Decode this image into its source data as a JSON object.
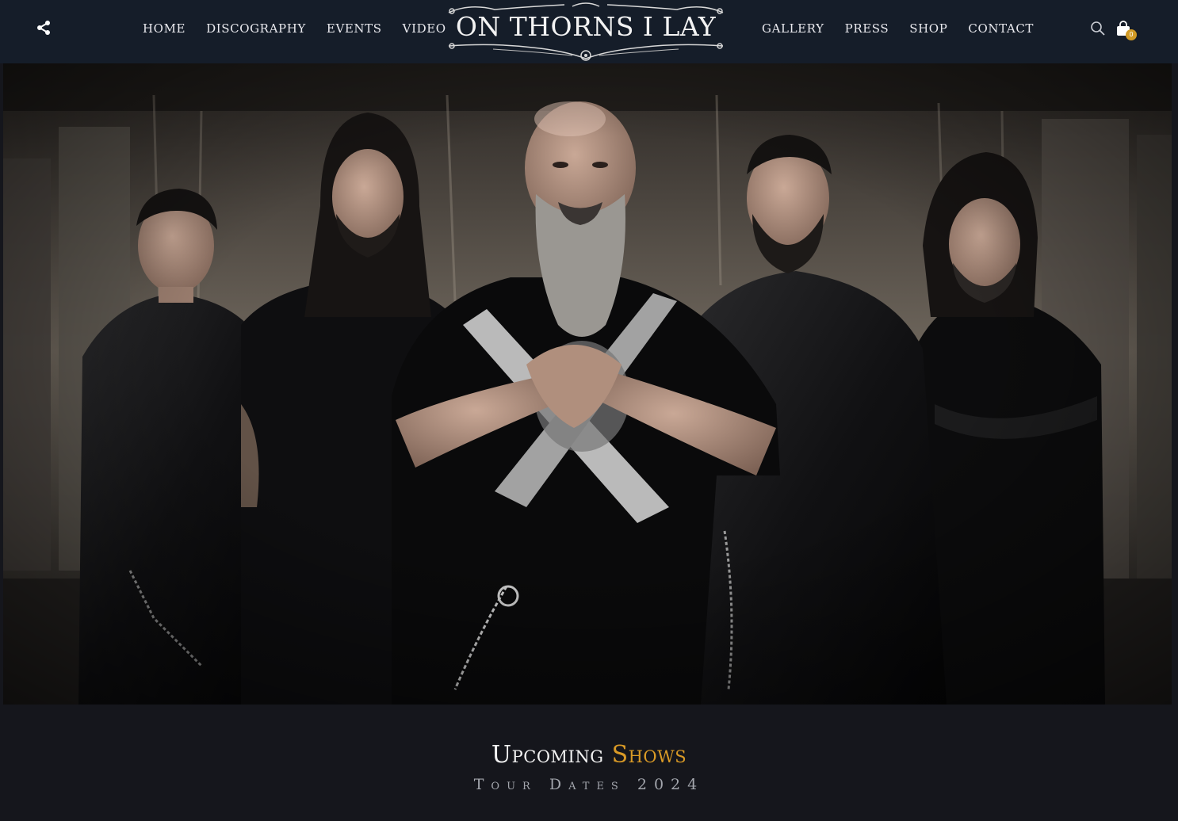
{
  "header": {
    "nav_left": [
      "Home",
      "Discography",
      "Events",
      "Video"
    ],
    "nav_right": [
      "Gallery",
      "Press",
      "Shop",
      "Contact"
    ],
    "logo_text": "ON THORNS I LAY",
    "cart_count": "0",
    "icons": {
      "share": "share-icon",
      "search": "search-icon",
      "cart": "cart-icon"
    }
  },
  "hero": {
    "image": "band-photo"
  },
  "shows": {
    "title_word1": "Upcoming",
    "title_word2": "Shows",
    "subtitle": "Tour Dates 2024"
  },
  "colors": {
    "header_bg": "#151d29",
    "page_bg": "#15161c",
    "accent": "#d99a26",
    "text": "#f2f2f2",
    "muted": "#a3a6ad"
  }
}
